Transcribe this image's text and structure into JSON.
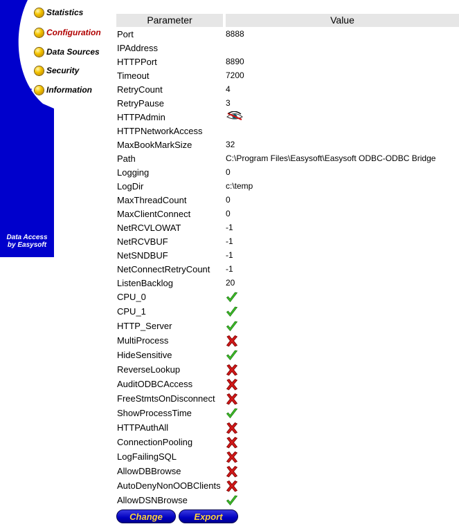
{
  "nav": {
    "items": [
      {
        "label": "Statistics",
        "active": false
      },
      {
        "label": "Configuration",
        "active": true
      },
      {
        "label": "Data Sources",
        "active": false
      },
      {
        "label": "Security",
        "active": false
      },
      {
        "label": "Information",
        "active": false
      }
    ],
    "brand_line1": "Data Access",
    "brand_line2": "by Easysoft",
    "panel_color": "#0000cc"
  },
  "table": {
    "headers": {
      "parameter": "Parameter",
      "value": "Value"
    },
    "rows": [
      {
        "name": "Port",
        "value": "8888",
        "icon": null
      },
      {
        "name": "IPAddress",
        "value": "",
        "icon": null
      },
      {
        "name": "HTTPPort",
        "value": "8890",
        "icon": null
      },
      {
        "name": "Timeout",
        "value": "7200",
        "icon": null
      },
      {
        "name": "RetryCount",
        "value": "4",
        "icon": null
      },
      {
        "name": "RetryPause",
        "value": "3",
        "icon": null
      },
      {
        "name": "HTTPAdmin",
        "value": "",
        "icon": "eye-icon"
      },
      {
        "name": "HTTPNetworkAccess",
        "value": "",
        "icon": null
      },
      {
        "name": "MaxBookMarkSize",
        "value": "32",
        "icon": null
      },
      {
        "name": "Path",
        "value": "C:\\Program Files\\Easysoft\\Easysoft ODBC-ODBC Bridge",
        "icon": null
      },
      {
        "name": "Logging",
        "value": "0",
        "icon": null
      },
      {
        "name": "LogDir",
        "value": "c:\\temp",
        "icon": null
      },
      {
        "name": "MaxThreadCount",
        "value": "0",
        "icon": null
      },
      {
        "name": "MaxClientConnect",
        "value": "0",
        "icon": null
      },
      {
        "name": "NetRCVLOWAT",
        "value": "-1",
        "icon": null
      },
      {
        "name": "NetRCVBUF",
        "value": "-1",
        "icon": null
      },
      {
        "name": "NetSNDBUF",
        "value": "-1",
        "icon": null
      },
      {
        "name": "NetConnectRetryCount",
        "value": "-1",
        "icon": null
      },
      {
        "name": "ListenBacklog",
        "value": "20",
        "icon": null
      },
      {
        "name": "CPU_0",
        "value": "",
        "icon": "check-icon"
      },
      {
        "name": "CPU_1",
        "value": "",
        "icon": "check-icon"
      },
      {
        "name": "HTTP_Server",
        "value": "",
        "icon": "check-icon"
      },
      {
        "name": "MultiProcess",
        "value": "",
        "icon": "cross-icon"
      },
      {
        "name": "HideSensitive",
        "value": "",
        "icon": "check-icon"
      },
      {
        "name": "ReverseLookup",
        "value": "",
        "icon": "cross-icon"
      },
      {
        "name": "AuditODBCAccess",
        "value": "",
        "icon": "cross-icon"
      },
      {
        "name": "FreeStmtsOnDisconnect",
        "value": "",
        "icon": "cross-icon"
      },
      {
        "name": "ShowProcessTime",
        "value": "",
        "icon": "check-icon"
      },
      {
        "name": "HTTPAuthAll",
        "value": "",
        "icon": "cross-icon"
      },
      {
        "name": "ConnectionPooling",
        "value": "",
        "icon": "cross-icon"
      },
      {
        "name": "LogFailingSQL",
        "value": "",
        "icon": "cross-icon"
      },
      {
        "name": "AllowDBBrowse",
        "value": "",
        "icon": "cross-icon"
      },
      {
        "name": "AutoDenyNonOOBClients",
        "value": "",
        "icon": "cross-icon"
      },
      {
        "name": "AllowDSNBrowse",
        "value": "",
        "icon": "check-icon"
      }
    ]
  },
  "buttons": {
    "change": "Change",
    "export": "Export"
  }
}
